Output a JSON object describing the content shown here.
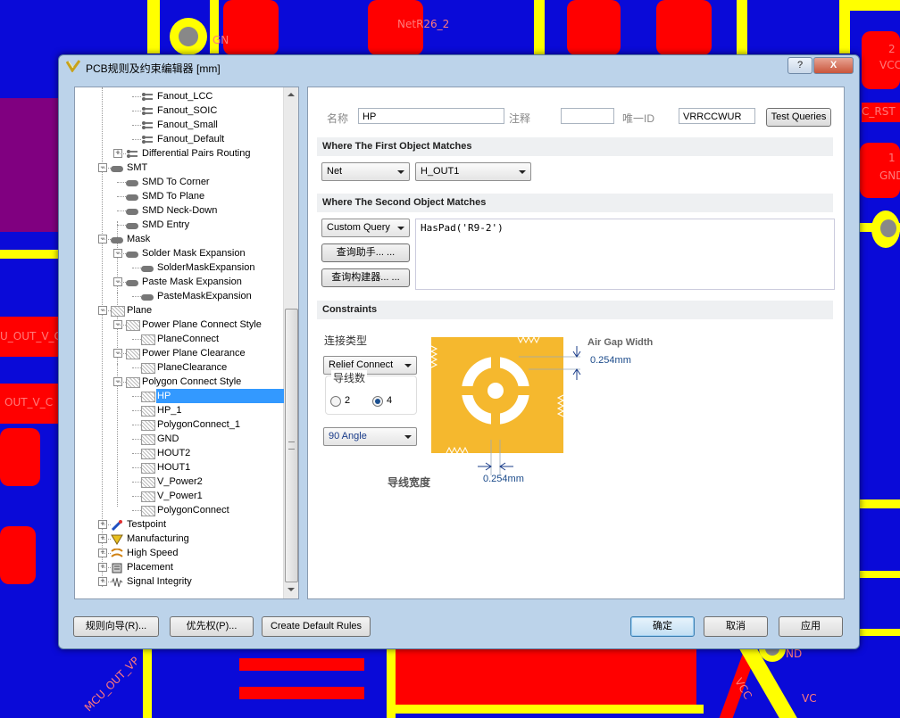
{
  "window": {
    "title": "PCB规则及约束编辑器 [mm]",
    "help": "?",
    "close": "X"
  },
  "background_labels": {
    "gn": "GN",
    "net1": "NetR26_2",
    "gnd": "GND",
    "vcc": "VCC",
    "rst": "C_RST",
    "two": "2",
    "one": "1",
    "gnd2": "GND",
    "mcu1": "U_OUT_V_C",
    "mcu2": "OUT_V_C",
    "mcu3": "MCU_OUT_VP",
    "vcc2": "VCC",
    "vcc3": "VC",
    "nd": "ND"
  },
  "tree": {
    "items": [
      {
        "label": "Fanout_LCC"
      },
      {
        "label": "Fanout_SOIC"
      },
      {
        "label": "Fanout_Small"
      },
      {
        "label": "Fanout_Default"
      },
      {
        "label": "Differential Pairs Routing"
      },
      {
        "label": "SMT"
      },
      {
        "label": "SMD To Corner"
      },
      {
        "label": "SMD To Plane"
      },
      {
        "label": "SMD Neck-Down"
      },
      {
        "label": "SMD Entry"
      },
      {
        "label": "Mask"
      },
      {
        "label": "Solder Mask Expansion"
      },
      {
        "label": "SolderMaskExpansion"
      },
      {
        "label": "Paste Mask Expansion"
      },
      {
        "label": "PasteMaskExpansion"
      },
      {
        "label": "Plane"
      },
      {
        "label": "Power Plane Connect Style"
      },
      {
        "label": "PlaneConnect"
      },
      {
        "label": "Power Plane Clearance"
      },
      {
        "label": "PlaneClearance"
      },
      {
        "label": "Polygon Connect Style"
      },
      {
        "label": "HP"
      },
      {
        "label": "HP_1"
      },
      {
        "label": "PolygonConnect_1"
      },
      {
        "label": "GND"
      },
      {
        "label": "HOUT2"
      },
      {
        "label": "HOUT1"
      },
      {
        "label": "V_Power2"
      },
      {
        "label": "V_Power1"
      },
      {
        "label": "PolygonConnect"
      },
      {
        "label": "Testpoint"
      },
      {
        "label": "Manufacturing"
      },
      {
        "label": "High Speed"
      },
      {
        "label": "Placement"
      },
      {
        "label": "Signal Integrity"
      }
    ]
  },
  "rule": {
    "name_label": "名称",
    "name_value": "HP",
    "comment_label": "注释",
    "comment_value": "",
    "uid_label": "唯一ID",
    "uid_value": "VRRCCWUR",
    "test_queries": "Test Queries"
  },
  "first": {
    "header": "Where The First Object Matches",
    "type": "Net",
    "value": "H_OUT1"
  },
  "second": {
    "header": "Where The Second Object Matches",
    "type": "Custom Query",
    "query": "HasPad('R9-2')",
    "helper_btn": "查询助手... ...",
    "builder_btn": "查询构建器... ..."
  },
  "constraints": {
    "header": "Constraints",
    "conn_type_label": "连接类型",
    "conn_type": "Relief Connect",
    "conductors_label": "导线数",
    "opt2": "2",
    "opt4": "4",
    "selected_conductors": 4,
    "angle": "90 Angle",
    "air_gap_label": "Air Gap Width",
    "air_gap": "0.254mm",
    "width_label": "导线宽度",
    "width": "0.254mm"
  },
  "bottom": {
    "wizard": "规则向导(R)...",
    "priority": "优先权(P)...",
    "default_rules": "Create Default Rules",
    "ok": "确定",
    "cancel": "取消",
    "apply": "应用"
  },
  "colors": {
    "pcb_blue": "#0a0ad8",
    "pcb_red": "#ff0000",
    "pcb_yellow": "#ffff00",
    "copper": "#f5b82e",
    "selected": "#3399ff"
  }
}
